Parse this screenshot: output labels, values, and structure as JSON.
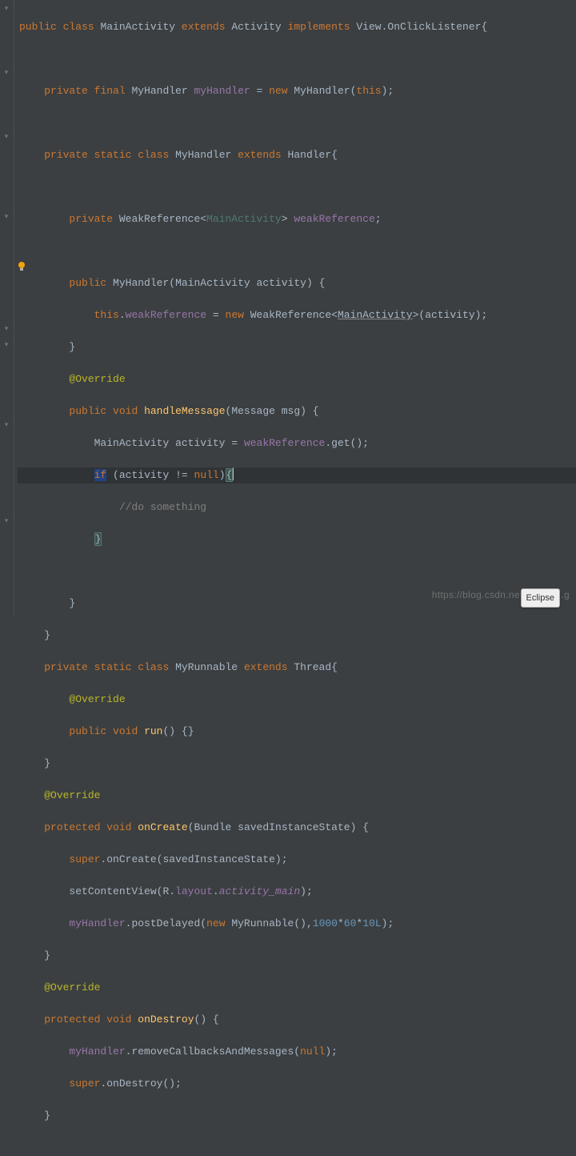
{
  "tokens": {
    "kw_public": "public",
    "kw_class": "class",
    "kw_extends": "extends",
    "kw_implements": "implements",
    "kw_private": "private",
    "kw_final": "final",
    "kw_static": "static",
    "kw_new": "new",
    "kw_this": "this",
    "kw_void": "void",
    "kw_protected": "protected",
    "kw_super": "super",
    "kw_null": "null",
    "kw_if": "if",
    "cls_MainActivity": "MainActivity",
    "cls_Activity": "Activity",
    "cls_View": "View",
    "cls_OnClickListener": "OnClickListener",
    "cls_MyHandler": "MyHandler",
    "cls_Handler": "Handler",
    "cls_WeakReference": "WeakReference",
    "cls_Message": "Message",
    "cls_MyRunnable": "MyRunnable",
    "cls_Thread": "Thread",
    "cls_Bundle": "Bundle",
    "cls_R": "R",
    "fld_myHandler": "myHandler",
    "fld_weakReference": "weakReference",
    "fld_layout": "layout",
    "fld_activity_main": "activity_main",
    "var_activity": "activity",
    "var_msg": "msg",
    "var_savedInstanceState": "savedInstanceState",
    "mth_handleMessage": "handleMessage",
    "mth_run": "run",
    "mth_onCreate": "onCreate",
    "mth_onDestroy": "onDestroy",
    "mth_get": "get",
    "mth_onCreateCall": "onCreate",
    "mth_setContentView": "setContentView",
    "mth_postDelayed": "postDelayed",
    "mth_removeCallbacksAndMessages": "removeCallbacksAndMessages",
    "mth_onDestroyCall": "onDestroy",
    "ann_Override": "@Override",
    "cmt_do_something": "//do something",
    "num_1000": "1000",
    "num_60": "60",
    "num_10L": "10L",
    "op_ne": "!=",
    "op_star": "*",
    "lt": "<",
    "gt": ">",
    "lbrace": "{",
    "rbrace": "}",
    "lparen": "(",
    "rparen": ")",
    "semi": ";",
    "dot": ".",
    "comma": ",",
    "eq": "=",
    "sp": " "
  },
  "watermark": "https://blog.csdn.net/@510f...g",
  "tag_label": "Eclipse"
}
